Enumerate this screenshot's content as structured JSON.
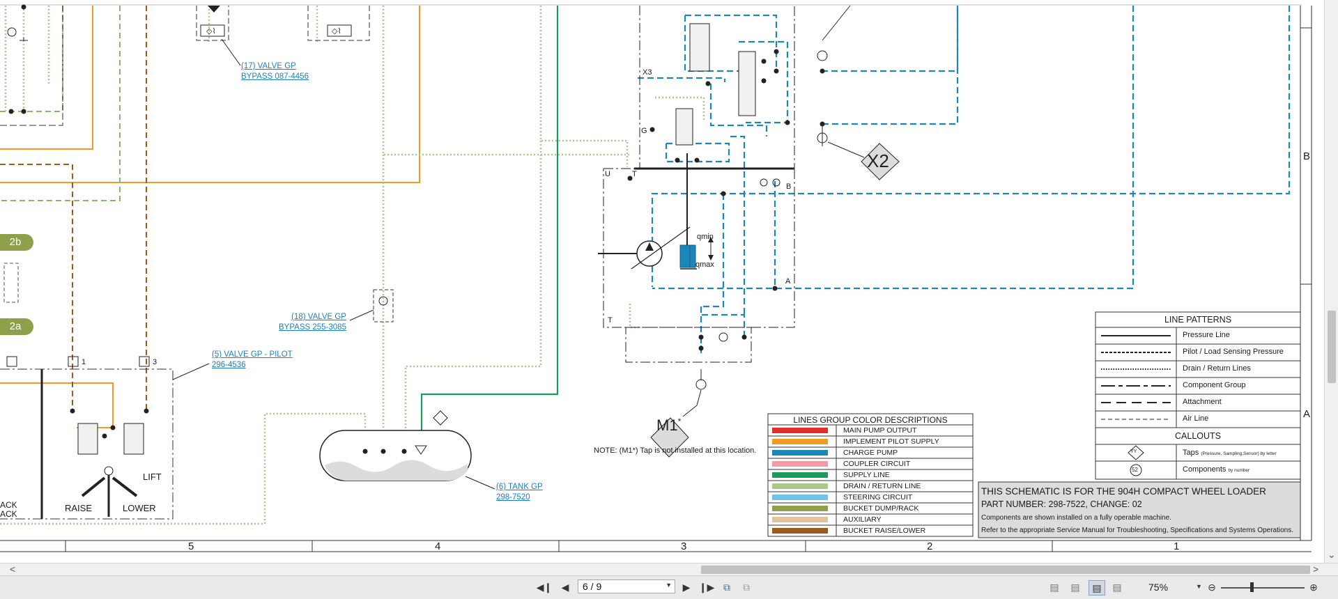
{
  "viewer": {
    "page_indicator": "6 / 9",
    "zoom": "75%",
    "hscroll_left_arrow": "<",
    "hscroll_right_arrow": ">",
    "vscroll_down_arrow": "⌄"
  },
  "schematic": {
    "zone_columns": [
      "5",
      "4",
      "3",
      "2",
      "1"
    ],
    "zone_rows": [
      "B",
      "A"
    ],
    "callouts": {
      "valve17_line1": "(17) VALVE GP",
      "valve17_line2": "BYPASS 087-4456",
      "valve18_line1": "(18) VALVE GP",
      "valve18_line2": "BYPASS 255-3085",
      "valve5_line1": "(5) VALVE GP - PILOT",
      "valve5_line2": "296-4536",
      "tank6_line1": "(6) TANK GP",
      "tank6_line2": "298-7520"
    },
    "ports": {
      "x3": "X3",
      "g": "G",
      "u": "U",
      "t_top": "T",
      "b": "B",
      "a": "A",
      "t_bottom": "T",
      "qmin": "qmin",
      "qmax": "qmax"
    },
    "taps": {
      "x2": "X2",
      "m1": "M1",
      "m1_star": "*"
    },
    "badges": {
      "b2b": "2b",
      "b2a": "2a"
    },
    "pilot": {
      "num1": "1",
      "num3": "3",
      "raise": "RAISE",
      "lower": "LOWER",
      "lift": "LIFT",
      "rack1": "ACK",
      "rack2": "ACK"
    },
    "note": "NOTE: (M1*) Tap is not installed at this location."
  },
  "line_patterns": {
    "title": "LINE PATTERNS",
    "rows": [
      {
        "label": "Pressure Line"
      },
      {
        "label": "Pilot / Load Sensing Pressure"
      },
      {
        "label": "Drain / Return Lines"
      },
      {
        "label": "Component Group"
      },
      {
        "label": "Attachment"
      },
      {
        "label": "Air Line"
      }
    ],
    "callouts_title": "CALLOUTS",
    "taps_symbol": "YY",
    "taps_label": "Taps",
    "taps_note": "(Pressure, Sampling,Sensor) by letter",
    "components_symbol": "52",
    "components_label": "Components",
    "components_note": "by number"
  },
  "color_legend": {
    "title": "LINES GROUP COLOR DESCRIPTIONS",
    "rows": [
      {
        "label": "MAIN PUMP OUTPUT",
        "color": "#e0302c"
      },
      {
        "label": "IMPLEMENT PILOT SUPPLY",
        "color": "#f39a23"
      },
      {
        "label": "CHARGE PUMP",
        "color": "#1a86b9"
      },
      {
        "label": "COUPLER CIRCUIT",
        "color": "#f29aa6"
      },
      {
        "label": "SUPPLY LINE",
        "color": "#1b9a5a"
      },
      {
        "label": "DRAIN / RETURN LINE",
        "color": "#a8c98a"
      },
      {
        "label": "STEERING CIRCUIT",
        "color": "#6cc4e6"
      },
      {
        "label": "BUCKET DUMP/RACK",
        "color": "#8ea14a"
      },
      {
        "label": "AUXILIARY",
        "color": "#e2c3a0"
      },
      {
        "label": "BUCKET RAISE/LOWER",
        "color": "#9a5b1c"
      }
    ]
  },
  "title_block": {
    "line1": "THIS SCHEMATIC IS FOR THE 904H COMPACT WHEEL LOADER",
    "line2": "PART NUMBER: 298-7522, CHANGE: 02",
    "line3": "Components are shown installed on a fully operable machine.",
    "line4": "Refer to the appropriate Service Manual for Troubleshooting, Specifications and Systems Operations."
  },
  "colors": {
    "orange": "#f39a23",
    "brown": "#9a5b1c",
    "green_dash": "#8bb36a",
    "drain": "#a8c98a",
    "blue": "#1a86b9",
    "supply": "#1b9a5a",
    "link": "#1a7fc0"
  }
}
